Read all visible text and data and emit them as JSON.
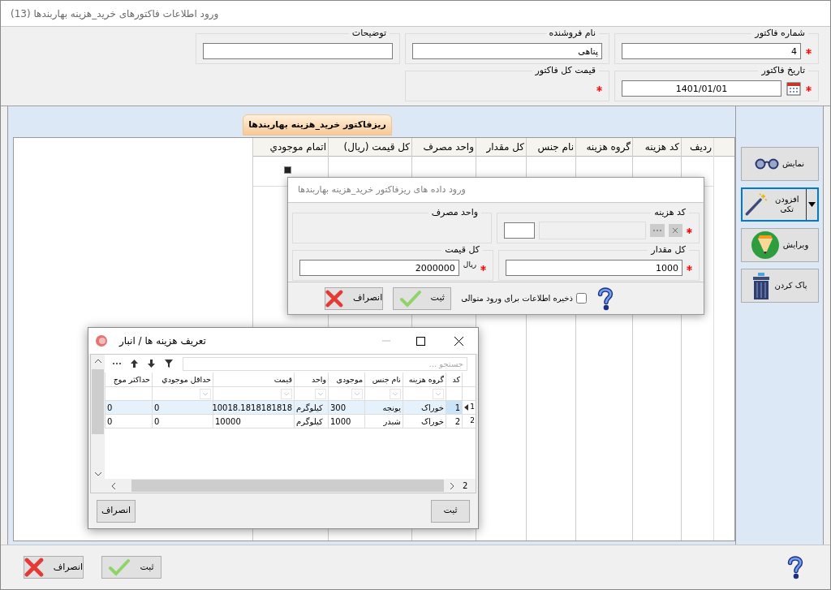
{
  "window": {
    "title": "ورود اطلاعات فاکتورهای خرید_هزینه بهاربندها (13)"
  },
  "header": {
    "rows": [
      [
        {
          "label": "شماره فاکتور",
          "value": "4",
          "required": true,
          "kind": "text"
        },
        {
          "label": "نام فروشنده",
          "value": "پناهی",
          "required": false,
          "kind": "text"
        },
        {
          "label": "توضیحات",
          "required": false,
          "kind": "text"
        }
      ],
      [
        {
          "label": "تاریخ فاکتور",
          "value": "1401/01/01",
          "required": true,
          "kind": "date"
        },
        {
          "label": "قیمت کل فاکتور",
          "required": true,
          "kind": "display"
        }
      ]
    ]
  },
  "subform": {
    "tab": "ریزفاکتور خرید_هزینه بهاربندها",
    "columns": [
      "ردیف",
      "کد هزینه",
      "گروه هزینه",
      "نام جنس",
      "کل مقدار",
      "واحد مصرف",
      "کل قیمت (ریال)",
      "اتمام موجودي"
    ]
  },
  "side_buttons": [
    {
      "label": "نمایش",
      "kind": "glasses",
      "selected": false,
      "dropdown": false
    },
    {
      "label": "افزودن تکی",
      "kind": "wand",
      "selected": true,
      "dropdown": true
    },
    {
      "label": "ویرایش",
      "kind": "pencil",
      "selected": false,
      "dropdown": false
    },
    {
      "label": "پاک کردن",
      "kind": "trash",
      "selected": false,
      "dropdown": false
    }
  ],
  "entry_dialog": {
    "title": "ورود داده های ریزفاکتور خرید_هزینه بهاربندها",
    "fields": [
      {
        "label": "کد هزینه",
        "kind": "code",
        "required": true
      },
      {
        "label": "واحد مصرف",
        "kind": "display",
        "required": false
      },
      {
        "label": "کل مقدار",
        "kind": "text",
        "value": "1000",
        "required": true
      },
      {
        "label": "کل قیمت",
        "kind": "text",
        "value": "2000000",
        "unit": "ریال",
        "required": true
      }
    ],
    "checkbox": {
      "label": "ذخیره اطلاعات برای ورود متوالی",
      "checked": false
    },
    "buttons": [
      {
        "label": "ثبت",
        "kind": "save"
      },
      {
        "label": "انصراف",
        "kind": "cancel"
      }
    ]
  },
  "lookup_dialog": {
    "title": "تعریف هزینه ها / انبار",
    "search": {
      "placeholder": "جستجو ..."
    },
    "columns": [
      "کد",
      "گروه هزینه",
      "نام جنس",
      "موجودی",
      "واحد",
      "قیمت",
      "حداقل موجودي",
      "حداکثر موج"
    ],
    "rows": [
      {
        "number": "1",
        "selected": true,
        "cells": [
          "1",
          "خوراک",
          "یونجه",
          "300",
          "کیلوگرم",
          "10018.1818181818",
          "0",
          "0"
        ]
      },
      {
        "number": "2",
        "selected": false,
        "cells": [
          "2",
          "خوراک",
          "شبدر",
          "1000",
          "کیلوگرم",
          "10000",
          "0",
          "0"
        ]
      }
    ],
    "count": "2",
    "buttons": [
      "ثبت",
      "انصراف"
    ]
  },
  "footer": {
    "buttons": [
      {
        "label": "ثبت",
        "kind": "save"
      },
      {
        "label": "انصراف",
        "kind": "cancel"
      }
    ]
  }
}
